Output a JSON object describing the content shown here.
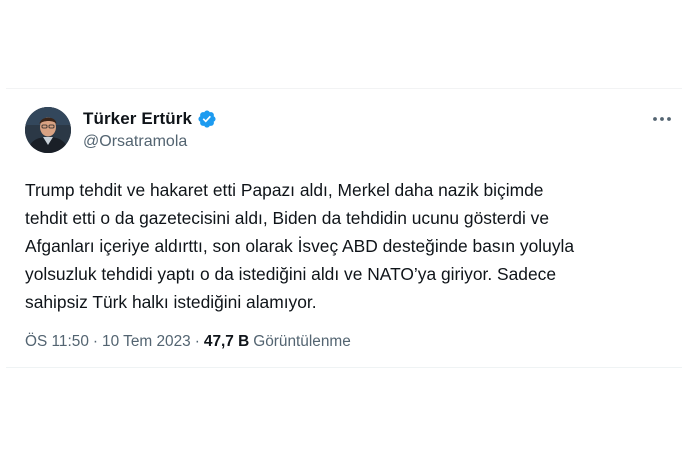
{
  "tweet": {
    "author": {
      "display_name": "Türker Ertürk",
      "handle": "@Orsatramola",
      "verified_color": "#1d9bf0"
    },
    "text_lines": [
      "Trump tehdit ve hakaret etti Papazı aldı, Merkel daha nazik biçimde",
      "tehdit etti o da gazetecisini aldı, Biden da tehdidin ucunu gösterdi ve",
      "Afganları içeriye aldırttı, son olarak İsveç ABD desteğinde basın yoluyla",
      "yolsuzluk tehdidi yaptı o da istediğini aldı ve NATO’ya giriyor. Sadece",
      "sahipsiz Türk halkı istediğini alamıyor."
    ],
    "meta": {
      "time": "ÖS 11:50",
      "separator": "·",
      "date": "10 Tem 2023",
      "views_count": "47,7 B",
      "views_label": "Görüntülenme"
    },
    "icons": {
      "verified": "verified-badge-icon",
      "more": "more-horizontal-icon"
    }
  }
}
